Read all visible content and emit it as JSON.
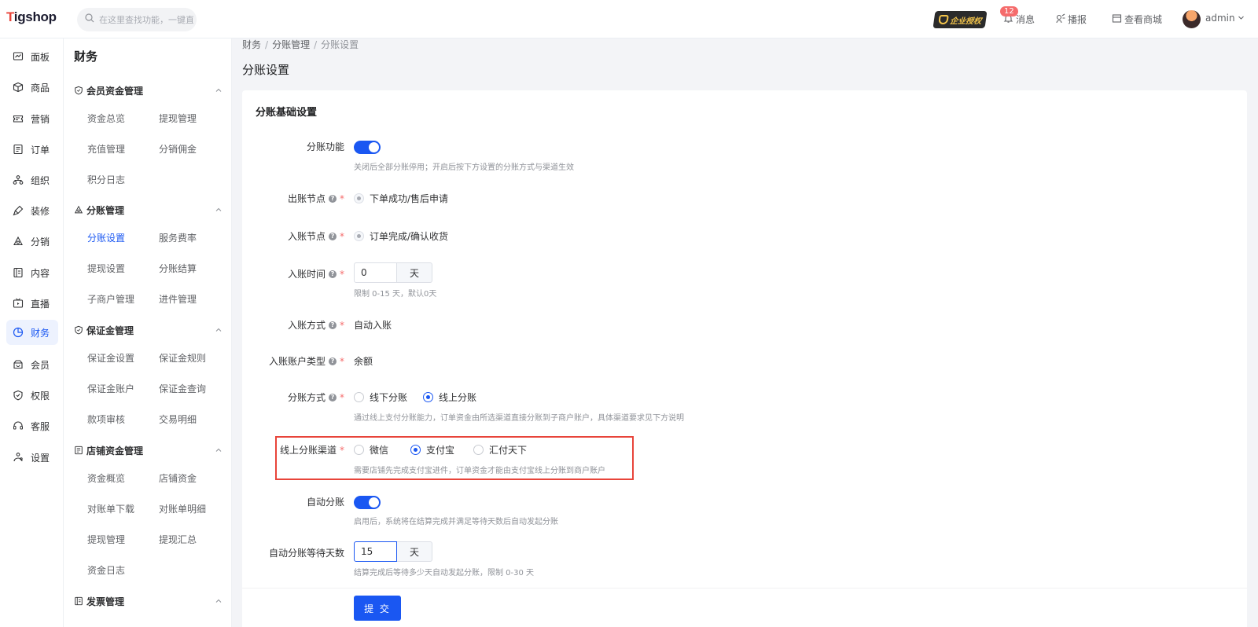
{
  "app": {
    "logo_prefix": "T",
    "logo_rest": "igshop",
    "search_placeholder": "在这里查找功能，一键直达"
  },
  "topbar": {
    "enterprise_badge": "企业授权",
    "message_label": "消息",
    "message_count": "12",
    "broadcast_label": "播报",
    "view_store_label": "查看商城",
    "user_name": "admin"
  },
  "nav": [
    {
      "label": "面板",
      "icon": "dashboard-icon"
    },
    {
      "label": "商品",
      "icon": "box-icon"
    },
    {
      "label": "营销",
      "icon": "ticket-icon"
    },
    {
      "label": "订单",
      "icon": "order-icon"
    },
    {
      "label": "组织",
      "icon": "org-icon"
    },
    {
      "label": "装修",
      "icon": "brush-icon"
    },
    {
      "label": "分销",
      "icon": "share-icon"
    },
    {
      "label": "内容",
      "icon": "content-icon"
    },
    {
      "label": "直播",
      "icon": "live-icon"
    },
    {
      "label": "财务",
      "icon": "finance-icon",
      "active": true
    },
    {
      "label": "会员",
      "icon": "member-icon"
    },
    {
      "label": "权限",
      "icon": "shield-icon"
    },
    {
      "label": "客服",
      "icon": "headset-icon"
    },
    {
      "label": "设置",
      "icon": "settings-icon"
    }
  ],
  "submenu": {
    "title": "财务",
    "groups": [
      {
        "title": "会员资金管理",
        "items": [
          "资金总览",
          "提现管理",
          "充值管理",
          "分销佣金",
          "积分日志"
        ]
      },
      {
        "title": "分账管理",
        "items": [
          "分账设置",
          "服务费率",
          "提现设置",
          "分账结算",
          "子商户管理",
          "进件管理"
        ]
      },
      {
        "title": "保证金管理",
        "items": [
          "保证金设置",
          "保证金规则",
          "保证金账户",
          "保证金查询",
          "款项审核",
          "交易明细"
        ]
      },
      {
        "title": "店铺资金管理",
        "items": [
          "资金概览",
          "店铺资金",
          "对账单下载",
          "对账单明细",
          "提现管理",
          "提现汇总",
          "资金日志"
        ]
      },
      {
        "title": "发票管理",
        "items": []
      }
    ]
  },
  "breadcrumb": [
    "财务",
    "分账管理",
    "分账设置"
  ],
  "page_title": "分账设置",
  "form": {
    "section_title": "分账基础设置",
    "split_function": {
      "label": "分账功能",
      "enabled": true,
      "hint": "关闭后全部分账停用；开启后按下方设置的分账方式与渠道生效"
    },
    "out_node": {
      "label": "出账节点",
      "value": "下单成功/售后申请"
    },
    "in_node": {
      "label": "入账节点",
      "value": "订单完成/确认收货"
    },
    "in_time": {
      "label": "入账时间",
      "value": "0",
      "unit": "天",
      "hint": "限制 0-15 天，默认0天"
    },
    "in_method": {
      "label": "入账方式",
      "value": "自动入账"
    },
    "in_account_type": {
      "label": "入账账户类型",
      "value": "余额"
    },
    "split_method": {
      "label": "分账方式",
      "options": [
        "线下分账",
        "线上分账"
      ],
      "selected": "线上分账",
      "hint": "通过线上支付分账能力，订单资金由所选渠道直接分账到子商户账户，具体渠道要求见下方说明"
    },
    "online_channel": {
      "label": "线上分账渠道",
      "options": [
        "微信",
        "支付宝",
        "汇付天下"
      ],
      "selected": "支付宝",
      "hint": "需要店铺先完成支付宝进件，订单资金才能由支付宝线上分账到商户账户"
    },
    "auto_split": {
      "label": "自动分账",
      "enabled": true,
      "hint": "启用后，系统将在结算完成并满足等待天数后自动发起分账"
    },
    "auto_wait_days": {
      "label": "自动分账等待天数",
      "value": "15",
      "unit": "天",
      "hint": "结算完成后等待多少天自动发起分账，限制 0-30 天"
    },
    "submit_label": "提 交"
  },
  "colors": {
    "accent": "#1a57f2",
    "danger": "#e8443a",
    "required": "#f56c6c"
  }
}
